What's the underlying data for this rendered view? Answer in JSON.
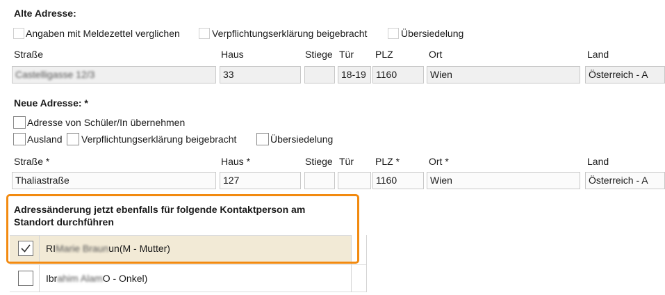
{
  "old_address": {
    "title": "Alte Adresse:",
    "options": [
      "Angaben mit Meldezettel verglichen",
      "Verpflichtungserklärung beigebracht",
      "Übersiedelung"
    ],
    "labels": {
      "street": "Straße",
      "house": "Haus",
      "stair": "Stiege",
      "door": "Tür",
      "zip": "PLZ",
      "city": "Ort",
      "country": "Land"
    },
    "values": {
      "street": "Castelligasse 12/3",
      "house": "33",
      "stair": "",
      "door": "18-19",
      "zip": "1160",
      "city": "Wien",
      "country": "Österreich - A"
    }
  },
  "new_address": {
    "title": "Neue Adresse: *",
    "take_over_label": "Adresse von Schüler/In übernehmen",
    "options": [
      "Ausland",
      "Verpflichtungserklärung beigebracht",
      "Übersiedelung"
    ],
    "labels": {
      "street": "Straße *",
      "house": "Haus *",
      "stair": "Stiege",
      "door": "Tür",
      "zip": "PLZ *",
      "city": "Ort *",
      "country": "Land"
    },
    "values": {
      "street": "Thaliastraße",
      "house": "127",
      "stair": "",
      "door": "",
      "zip": "1160",
      "city": "Wien",
      "country": "Österreich - A"
    }
  },
  "contacts": {
    "title_line1": "Adressänderung jetzt ebenfalls für folgende Kontaktperson am",
    "title_line2": "Standort durchführen",
    "rows": [
      {
        "name_prefix": "RI",
        "name_blur": "Marie Braun",
        "name_suffix": "un(M - Mutter)",
        "checked": true
      },
      {
        "name_prefix": "Ibr",
        "name_blur": "ahim Alam",
        "name_suffix": "O - Onkel)",
        "checked": false
      }
    ]
  },
  "colors": {
    "highlight_border": "#f28a10",
    "selected_row": "#f2ead6"
  }
}
